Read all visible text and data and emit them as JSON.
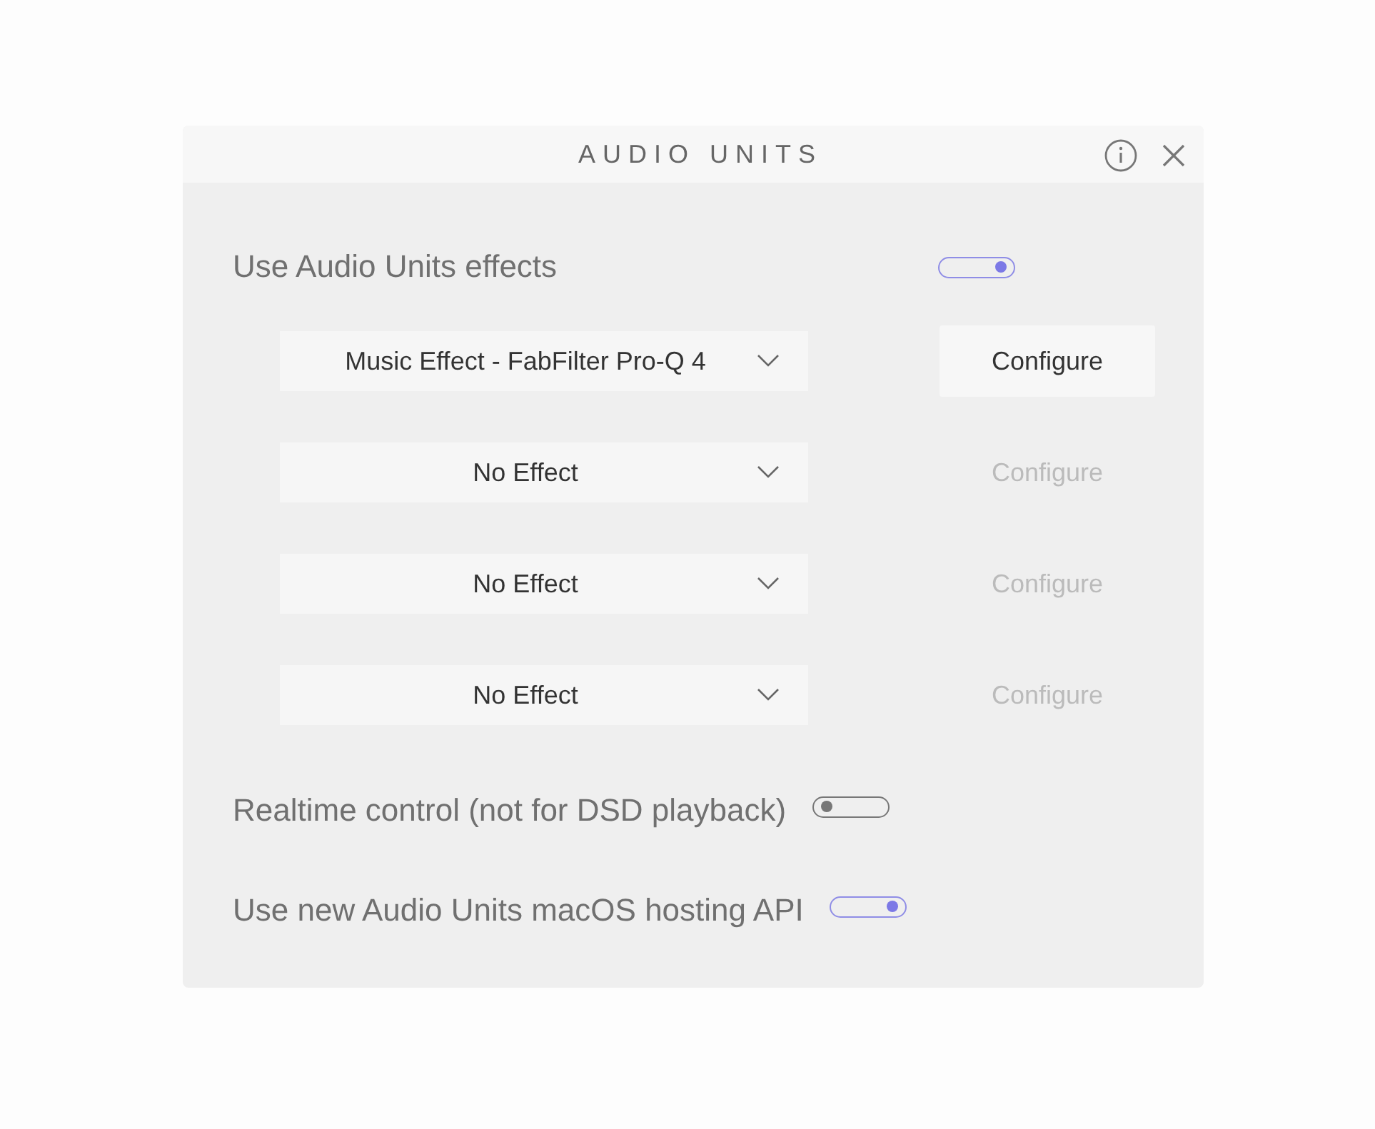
{
  "window": {
    "title": "AUDIO UNITS"
  },
  "effects_toggle": {
    "label": "Use Audio Units effects",
    "on": true
  },
  "effect_slots": [
    {
      "value": "Music Effect - FabFilter Pro-Q 4",
      "configure": {
        "label": "Configure",
        "disabled": false
      }
    },
    {
      "value": "No Effect",
      "configure": {
        "label": "Configure",
        "disabled": true
      }
    },
    {
      "value": "No Effect",
      "configure": {
        "label": "Configure",
        "disabled": true
      }
    },
    {
      "value": "No Effect",
      "configure": {
        "label": "Configure",
        "disabled": true
      }
    }
  ],
  "options": [
    {
      "label": "Realtime control (not for DSD playback)",
      "on": false
    },
    {
      "label": "Use new Audio Units macOS hosting API",
      "on": true
    }
  ]
}
